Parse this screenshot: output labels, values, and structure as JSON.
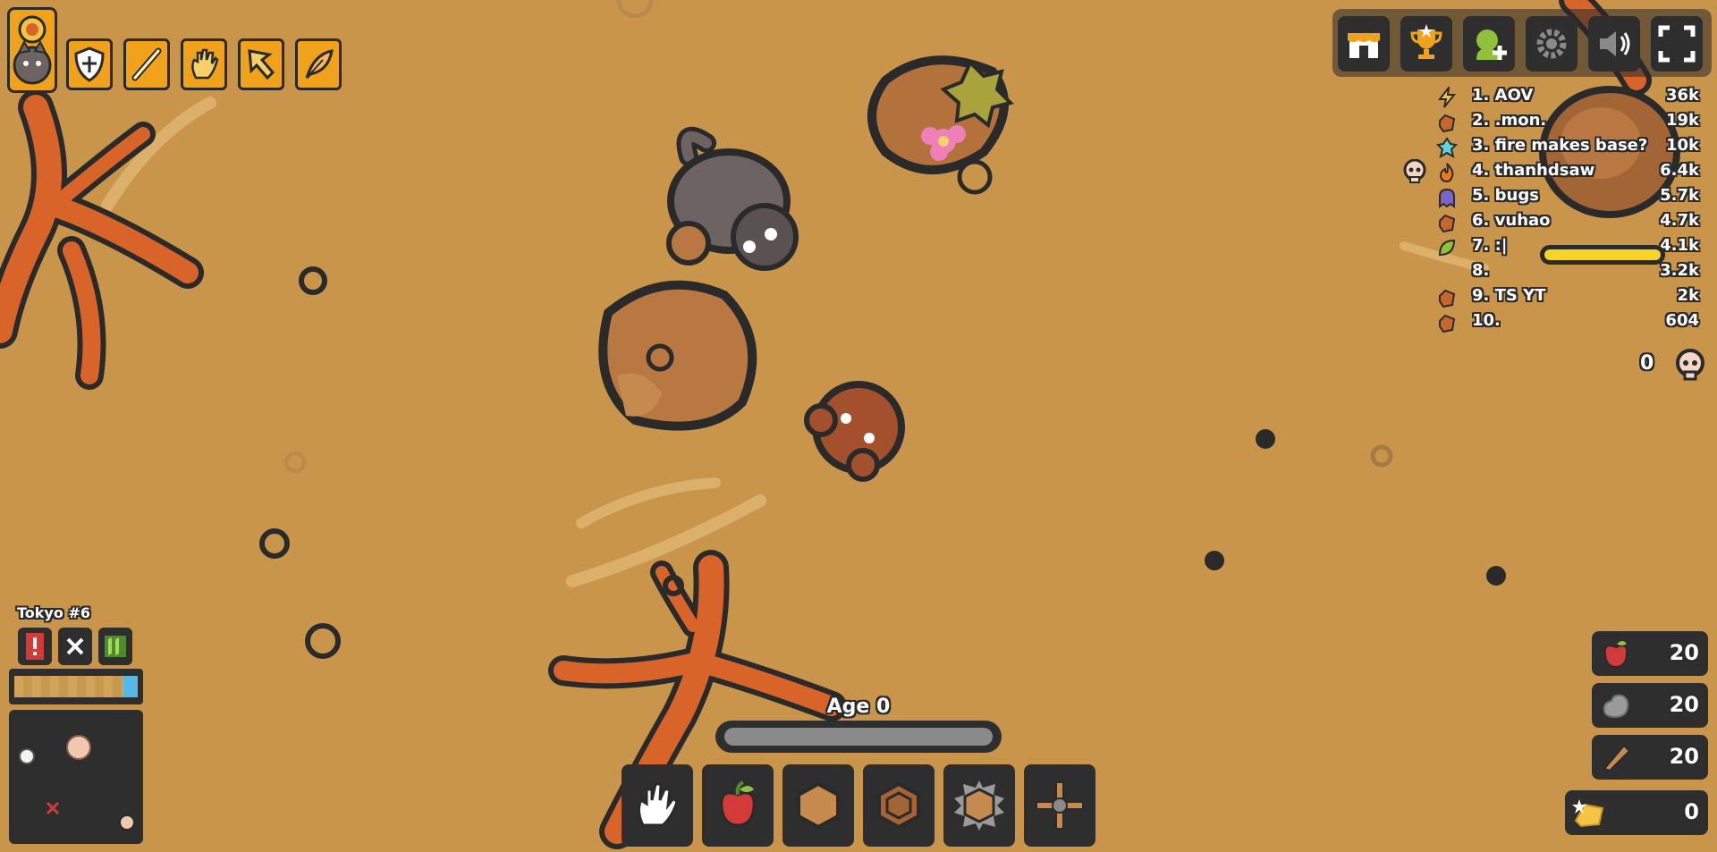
{
  "server": {
    "label": "Tokyo #6"
  },
  "leaderboard": [
    {
      "rank": "1.",
      "name": "AOV",
      "score": "36k",
      "icon": "lightning-icon"
    },
    {
      "rank": "2.",
      "name": ".mon.",
      "score": "19k",
      "icon": "fist-icon"
    },
    {
      "rank": "3.",
      "name": "fire makes base?",
      "score": "10k",
      "icon": "crystal-icon"
    },
    {
      "rank": "4.",
      "name": "thanhdsaw",
      "score": "6.4k",
      "icon": "fire-icon"
    },
    {
      "rank": "5.",
      "name": "bugs",
      "score": "5.7k",
      "icon": "ghost-icon"
    },
    {
      "rank": "6.",
      "name": "vuhao",
      "score": "4.7k",
      "icon": "fist-icon"
    },
    {
      "rank": "7.",
      "name": ":|",
      "score": "4.1k",
      "icon": "leaf-icon"
    },
    {
      "rank": "8.",
      "name": "",
      "score": "3.2k",
      "icon": ""
    },
    {
      "rank": "9.",
      "name": "TS YT",
      "score": "2k",
      "icon": "fist-icon"
    },
    {
      "rank": "10.",
      "name": "",
      "score": "604",
      "icon": "fist-icon"
    }
  ],
  "kills": {
    "count": "0"
  },
  "age": {
    "label": "Age 0",
    "progress": 0
  },
  "resources": {
    "food": "20",
    "stone": "20",
    "wood": "20",
    "gold": "0"
  },
  "hotbar": [
    {
      "name": "hand",
      "icon": "hand-icon"
    },
    {
      "name": "apple",
      "icon": "apple-icon"
    },
    {
      "name": "wood-wall",
      "icon": "wood-wall-icon"
    },
    {
      "name": "stone-wall",
      "icon": "stone-wall-icon"
    },
    {
      "name": "spike",
      "icon": "spike-icon"
    },
    {
      "name": "windmill",
      "icon": "windmill-icon"
    }
  ],
  "toolbar": [
    "shop-icon",
    "trophy-icon",
    "clan-add-icon",
    "settings-icon",
    "sound-icon",
    "fullscreen-icon"
  ],
  "skills": [
    "shield-icon",
    "sword-icon",
    "hand-skill-icon",
    "cursor-icon",
    "feather-icon"
  ],
  "colors": {
    "ground": "#c9954a",
    "tree": "#d8642a",
    "outline": "#2a2a2a",
    "accent": "#f0a21a"
  }
}
